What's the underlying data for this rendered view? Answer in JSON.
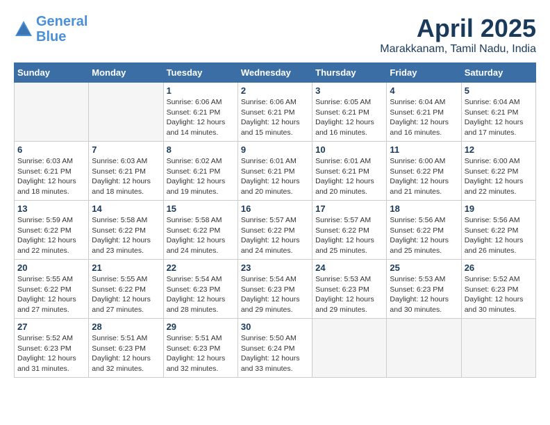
{
  "logo": {
    "line1": "General",
    "line2": "Blue"
  },
  "title": "April 2025",
  "subtitle": "Marakkanam, Tamil Nadu, India",
  "days_header": [
    "Sunday",
    "Monday",
    "Tuesday",
    "Wednesday",
    "Thursday",
    "Friday",
    "Saturday"
  ],
  "weeks": [
    [
      {
        "day": "",
        "sunrise": "",
        "sunset": "",
        "daylight": ""
      },
      {
        "day": "",
        "sunrise": "",
        "sunset": "",
        "daylight": ""
      },
      {
        "day": "1",
        "sunrise": "Sunrise: 6:06 AM",
        "sunset": "Sunset: 6:21 PM",
        "daylight": "Daylight: 12 hours and 14 minutes."
      },
      {
        "day": "2",
        "sunrise": "Sunrise: 6:06 AM",
        "sunset": "Sunset: 6:21 PM",
        "daylight": "Daylight: 12 hours and 15 minutes."
      },
      {
        "day": "3",
        "sunrise": "Sunrise: 6:05 AM",
        "sunset": "Sunset: 6:21 PM",
        "daylight": "Daylight: 12 hours and 16 minutes."
      },
      {
        "day": "4",
        "sunrise": "Sunrise: 6:04 AM",
        "sunset": "Sunset: 6:21 PM",
        "daylight": "Daylight: 12 hours and 16 minutes."
      },
      {
        "day": "5",
        "sunrise": "Sunrise: 6:04 AM",
        "sunset": "Sunset: 6:21 PM",
        "daylight": "Daylight: 12 hours and 17 minutes."
      }
    ],
    [
      {
        "day": "6",
        "sunrise": "Sunrise: 6:03 AM",
        "sunset": "Sunset: 6:21 PM",
        "daylight": "Daylight: 12 hours and 18 minutes."
      },
      {
        "day": "7",
        "sunrise": "Sunrise: 6:03 AM",
        "sunset": "Sunset: 6:21 PM",
        "daylight": "Daylight: 12 hours and 18 minutes."
      },
      {
        "day": "8",
        "sunrise": "Sunrise: 6:02 AM",
        "sunset": "Sunset: 6:21 PM",
        "daylight": "Daylight: 12 hours and 19 minutes."
      },
      {
        "day": "9",
        "sunrise": "Sunrise: 6:01 AM",
        "sunset": "Sunset: 6:21 PM",
        "daylight": "Daylight: 12 hours and 20 minutes."
      },
      {
        "day": "10",
        "sunrise": "Sunrise: 6:01 AM",
        "sunset": "Sunset: 6:21 PM",
        "daylight": "Daylight: 12 hours and 20 minutes."
      },
      {
        "day": "11",
        "sunrise": "Sunrise: 6:00 AM",
        "sunset": "Sunset: 6:22 PM",
        "daylight": "Daylight: 12 hours and 21 minutes."
      },
      {
        "day": "12",
        "sunrise": "Sunrise: 6:00 AM",
        "sunset": "Sunset: 6:22 PM",
        "daylight": "Daylight: 12 hours and 22 minutes."
      }
    ],
    [
      {
        "day": "13",
        "sunrise": "Sunrise: 5:59 AM",
        "sunset": "Sunset: 6:22 PM",
        "daylight": "Daylight: 12 hours and 22 minutes."
      },
      {
        "day": "14",
        "sunrise": "Sunrise: 5:58 AM",
        "sunset": "Sunset: 6:22 PM",
        "daylight": "Daylight: 12 hours and 23 minutes."
      },
      {
        "day": "15",
        "sunrise": "Sunrise: 5:58 AM",
        "sunset": "Sunset: 6:22 PM",
        "daylight": "Daylight: 12 hours and 24 minutes."
      },
      {
        "day": "16",
        "sunrise": "Sunrise: 5:57 AM",
        "sunset": "Sunset: 6:22 PM",
        "daylight": "Daylight: 12 hours and 24 minutes."
      },
      {
        "day": "17",
        "sunrise": "Sunrise: 5:57 AM",
        "sunset": "Sunset: 6:22 PM",
        "daylight": "Daylight: 12 hours and 25 minutes."
      },
      {
        "day": "18",
        "sunrise": "Sunrise: 5:56 AM",
        "sunset": "Sunset: 6:22 PM",
        "daylight": "Daylight: 12 hours and 25 minutes."
      },
      {
        "day": "19",
        "sunrise": "Sunrise: 5:56 AM",
        "sunset": "Sunset: 6:22 PM",
        "daylight": "Daylight: 12 hours and 26 minutes."
      }
    ],
    [
      {
        "day": "20",
        "sunrise": "Sunrise: 5:55 AM",
        "sunset": "Sunset: 6:22 PM",
        "daylight": "Daylight: 12 hours and 27 minutes."
      },
      {
        "day": "21",
        "sunrise": "Sunrise: 5:55 AM",
        "sunset": "Sunset: 6:22 PM",
        "daylight": "Daylight: 12 hours and 27 minutes."
      },
      {
        "day": "22",
        "sunrise": "Sunrise: 5:54 AM",
        "sunset": "Sunset: 6:23 PM",
        "daylight": "Daylight: 12 hours and 28 minutes."
      },
      {
        "day": "23",
        "sunrise": "Sunrise: 5:54 AM",
        "sunset": "Sunset: 6:23 PM",
        "daylight": "Daylight: 12 hours and 29 minutes."
      },
      {
        "day": "24",
        "sunrise": "Sunrise: 5:53 AM",
        "sunset": "Sunset: 6:23 PM",
        "daylight": "Daylight: 12 hours and 29 minutes."
      },
      {
        "day": "25",
        "sunrise": "Sunrise: 5:53 AM",
        "sunset": "Sunset: 6:23 PM",
        "daylight": "Daylight: 12 hours and 30 minutes."
      },
      {
        "day": "26",
        "sunrise": "Sunrise: 5:52 AM",
        "sunset": "Sunset: 6:23 PM",
        "daylight": "Daylight: 12 hours and 30 minutes."
      }
    ],
    [
      {
        "day": "27",
        "sunrise": "Sunrise: 5:52 AM",
        "sunset": "Sunset: 6:23 PM",
        "daylight": "Daylight: 12 hours and 31 minutes."
      },
      {
        "day": "28",
        "sunrise": "Sunrise: 5:51 AM",
        "sunset": "Sunset: 6:23 PM",
        "daylight": "Daylight: 12 hours and 32 minutes."
      },
      {
        "day": "29",
        "sunrise": "Sunrise: 5:51 AM",
        "sunset": "Sunset: 6:23 PM",
        "daylight": "Daylight: 12 hours and 32 minutes."
      },
      {
        "day": "30",
        "sunrise": "Sunrise: 5:50 AM",
        "sunset": "Sunset: 6:24 PM",
        "daylight": "Daylight: 12 hours and 33 minutes."
      },
      {
        "day": "",
        "sunrise": "",
        "sunset": "",
        "daylight": ""
      },
      {
        "day": "",
        "sunrise": "",
        "sunset": "",
        "daylight": ""
      },
      {
        "day": "",
        "sunrise": "",
        "sunset": "",
        "daylight": ""
      }
    ]
  ]
}
